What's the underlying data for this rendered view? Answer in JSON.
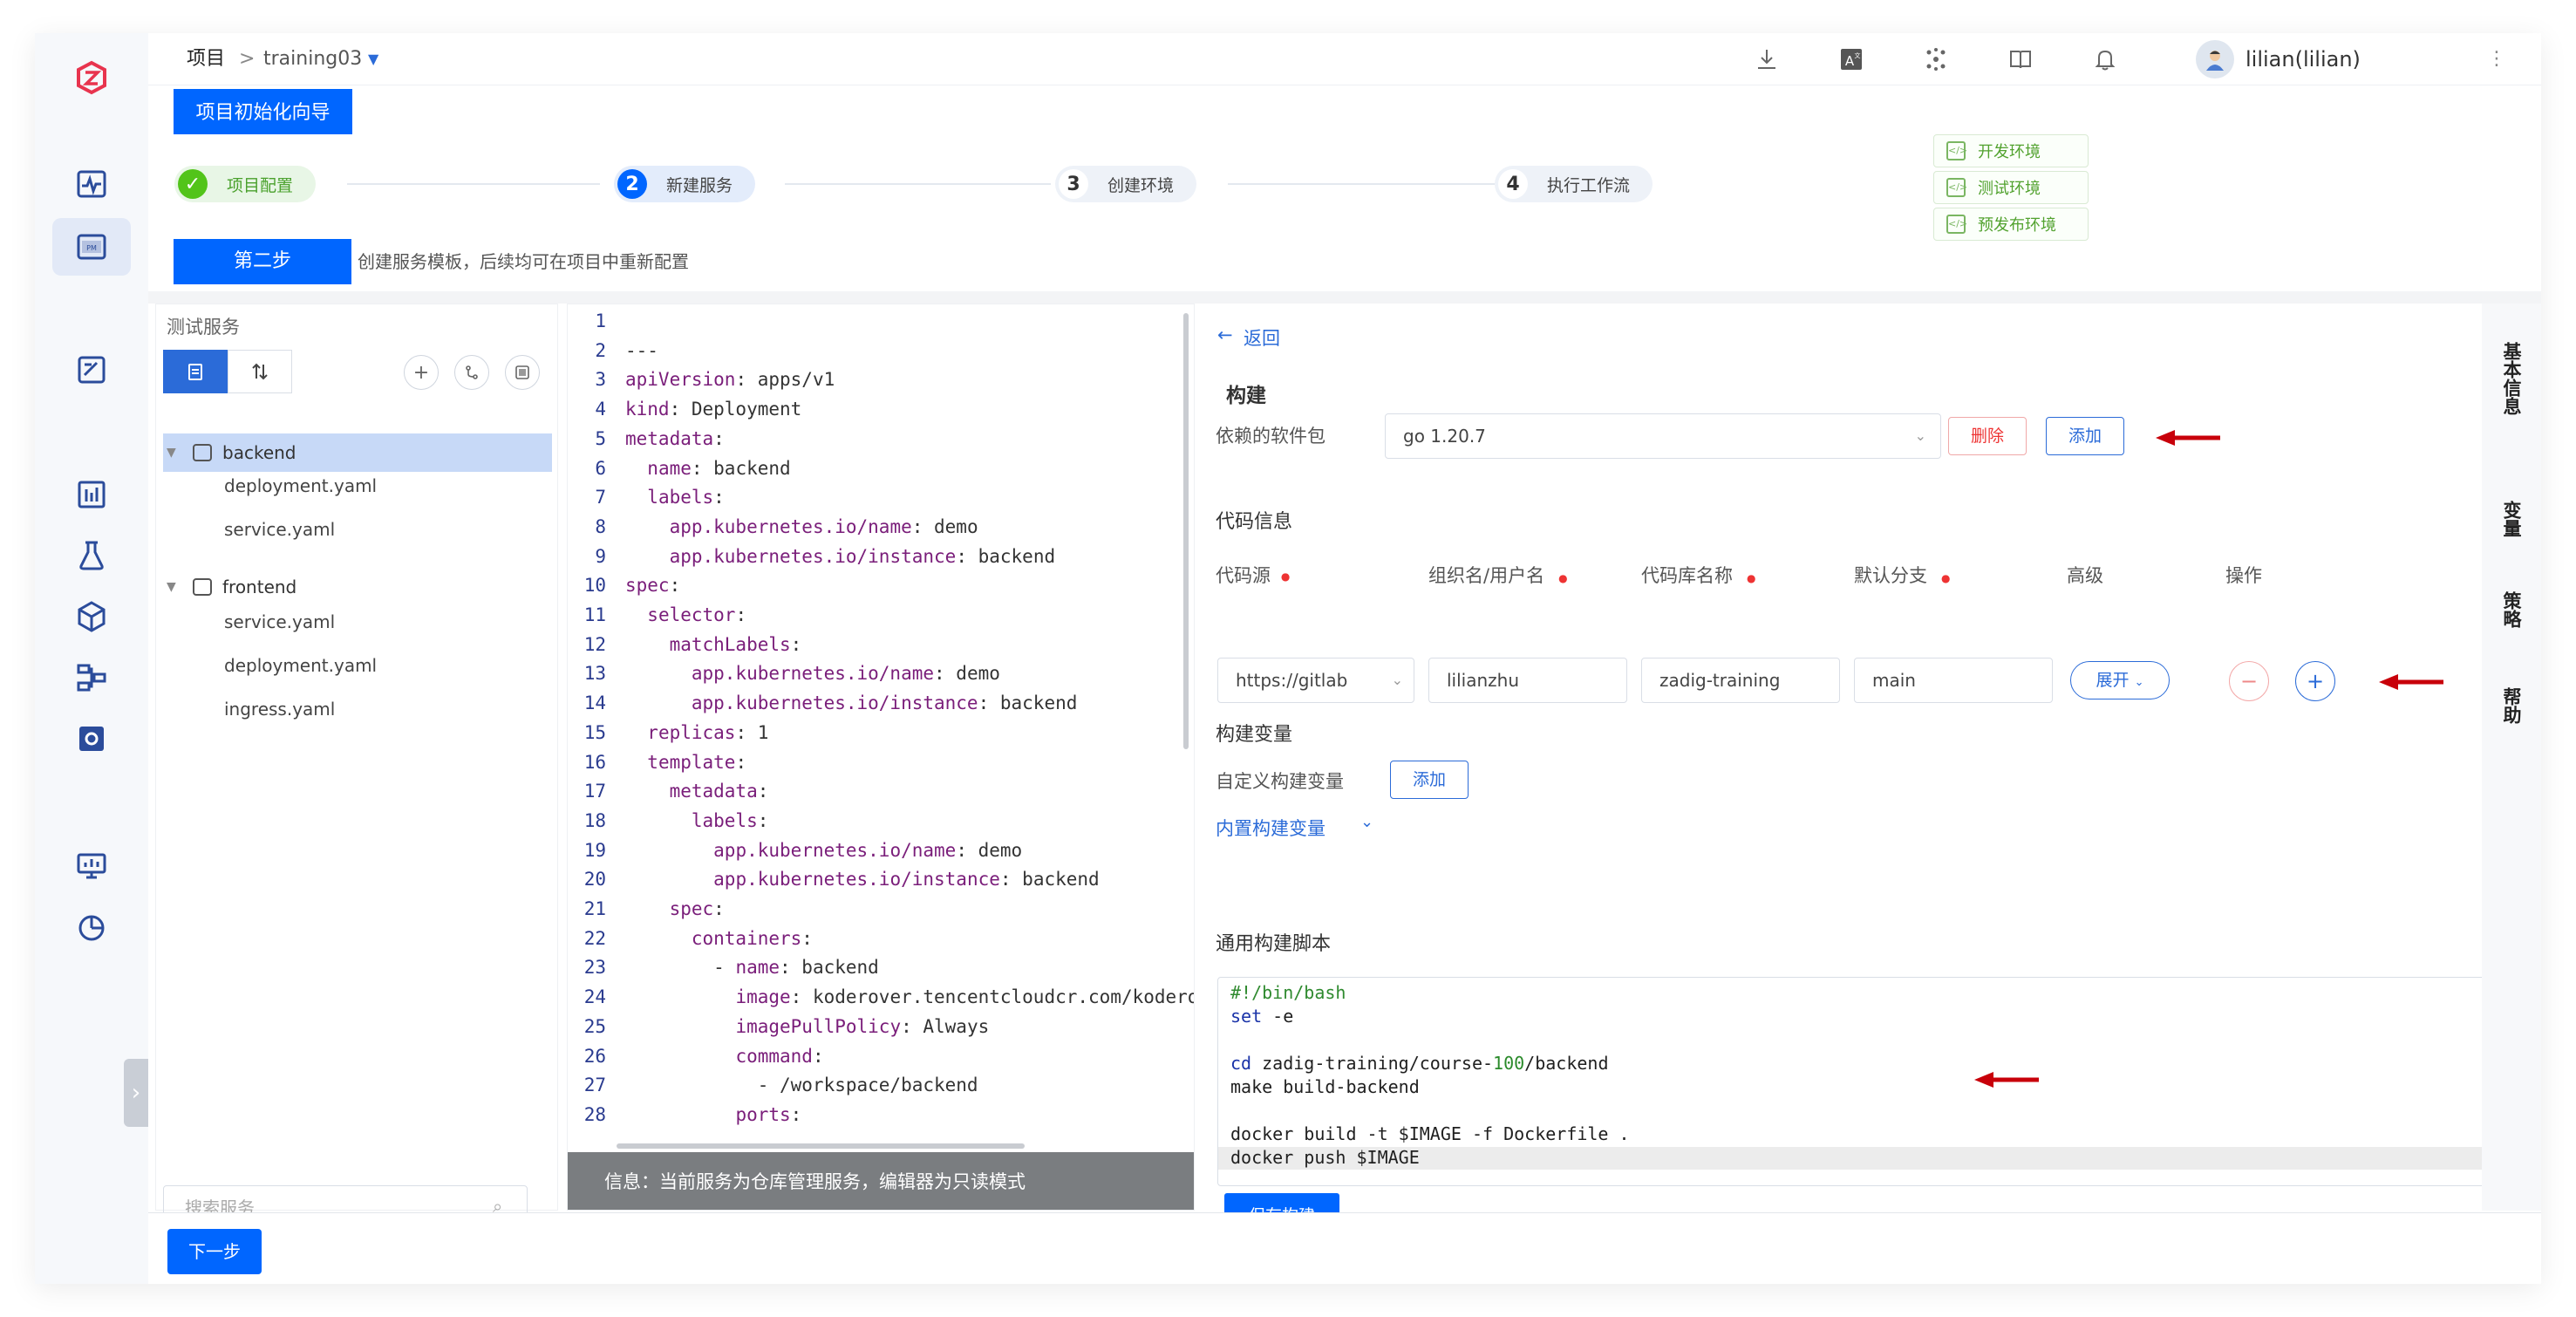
{
  "header": {
    "project_label": "项目",
    "separator": ">",
    "project_name": "training03",
    "user": "lilian(lilian)"
  },
  "wizard": {
    "guide_button": "项目初始化向导",
    "steps": [
      {
        "num": "✓",
        "label": "项目配置"
      },
      {
        "num": "2",
        "label": "新建服务"
      },
      {
        "num": "3",
        "label": "创建环境"
      },
      {
        "num": "4",
        "label": "执行工作流"
      }
    ],
    "envs": [
      "开发环境",
      "测试环境",
      "预发布环境"
    ],
    "step_badge": "第二步",
    "step_desc": "创建服务模板，后续均可在项目中重新配置"
  },
  "services": {
    "title": "测试服务",
    "search_placeholder": "搜索服务",
    "tree": [
      {
        "name": "backend",
        "files": [
          "deployment.yaml",
          "service.yaml"
        ]
      },
      {
        "name": "frontend",
        "files": [
          "service.yaml",
          "deployment.yaml",
          "ingress.yaml"
        ]
      }
    ]
  },
  "editor": {
    "lines": [
      "",
      "---",
      "apiVersion: apps/v1",
      "kind: Deployment",
      "metadata:",
      "  name: backend",
      "  labels:",
      "    app.kubernetes.io/name: demo",
      "    app.kubernetes.io/instance: backend",
      "spec:",
      "  selector:",
      "    matchLabels:",
      "      app.kubernetes.io/name: demo",
      "      app.kubernetes.io/instance: backend",
      "  replicas: 1",
      "  template:",
      "    metadata:",
      "      labels:",
      "        app.kubernetes.io/name: demo",
      "        app.kubernetes.io/instance: backend",
      "    spec:",
      "      containers:",
      "        - name: backend",
      "          image: koderover.tencentcloudcr.com/kodero",
      "          imagePullPolicy: Always",
      "          command:",
      "            - /workspace/backend",
      "          ports:"
    ],
    "info": "信息：当前服务为仓库管理服务，编辑器为只读模式"
  },
  "build": {
    "back": "返回",
    "title": "构建",
    "deps_label": "依赖的软件包",
    "deps_value": "go 1.20.7",
    "delete_btn": "删除",
    "add_btn": "添加",
    "code_info": "代码信息",
    "cols": {
      "source": "代码源",
      "org": "组织名/用户名",
      "repo": "代码库名称",
      "branch": "默认分支",
      "advanced": "高级",
      "ops": "操作"
    },
    "row": {
      "source": "https://gitlab",
      "org": "lilianzhu",
      "repo": "zadig-training",
      "branch": "main",
      "expand": "展开"
    },
    "vars_title": "构建变量",
    "custom_vars": "自定义构建变量",
    "custom_add": "添加",
    "builtin_vars": "内置构建变量",
    "script_title": "通用构建脚本",
    "script": [
      "#!/bin/bash",
      "set -e",
      "",
      "cd zadig-training/course-100/backend",
      "make build-backend",
      "",
      "docker build -t $IMAGE -f Dockerfile .",
      "docker push $IMAGE"
    ],
    "save": "保存构建"
  },
  "side_tabs": [
    "基本信息",
    "变量",
    "策略",
    "帮助"
  ],
  "footer": {
    "next": "下一步"
  },
  "colors": {
    "primary": "#0066ff",
    "success": "#52c41a",
    "danger": "#e33333",
    "annotation": "#cc0000"
  }
}
